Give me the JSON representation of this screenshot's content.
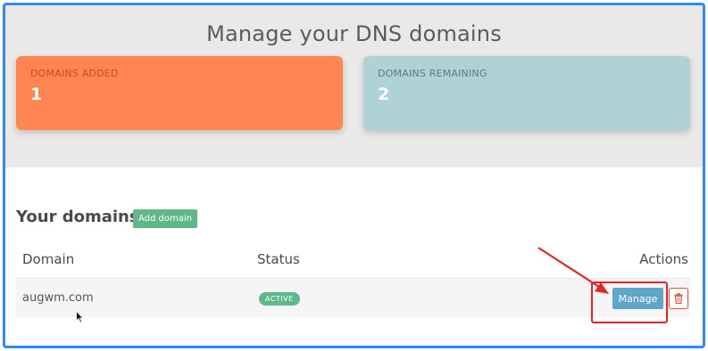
{
  "page_title": "Manage your DNS domains",
  "stats": {
    "added": {
      "label": "DOMAINS ADDED",
      "value": "1",
      "color": "#ff8552"
    },
    "remaining": {
      "label": "DOMAINS REMAINING",
      "value": "2",
      "color": "#afd3d4"
    }
  },
  "domains_section": {
    "title": "Your domains",
    "add_button": "Add domain"
  },
  "table": {
    "headers": {
      "domain": "Domain",
      "status": "Status",
      "actions": "Actions"
    },
    "rows": [
      {
        "domain": "augwm.com",
        "status": "ACTIVE",
        "manage_label": "Manage"
      }
    ]
  },
  "icons": {
    "delete": "trash-icon",
    "cursor": "mouse-pointer-icon",
    "annotation": "red-arrow-icon"
  },
  "colors": {
    "accent_green": "#5fb88a",
    "manage_blue": "#5fa6c9",
    "annotation_red": "#e8212b",
    "frame_blue": "#2f8bf2"
  }
}
